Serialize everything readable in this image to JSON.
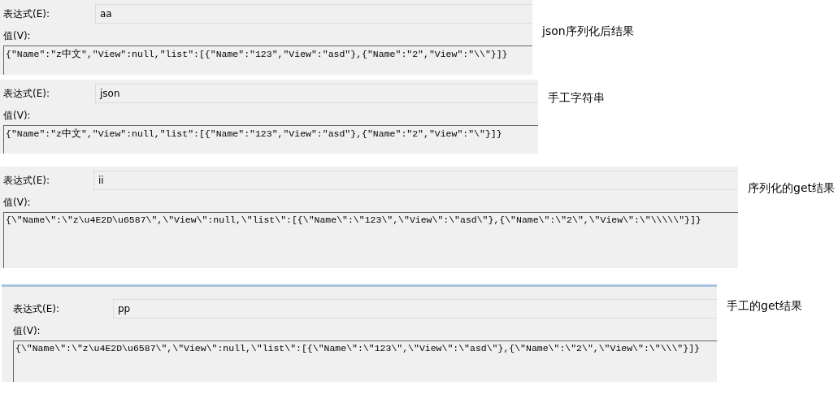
{
  "panels": [
    {
      "expression_label": "表达式(E):",
      "expression": "aa",
      "value_label": "值(V):",
      "value": "{\"Name\":\"z中文\",\"View\":null,\"list\":[{\"Name\":\"123\",\"View\":\"asd\"},{\"Name\":\"2\",\"View\":\"\\\\\"}]}",
      "caption": "json序列化后结果"
    },
    {
      "expression_label": "表达式(E):",
      "expression": "json",
      "value_label": "值(V):",
      "value": "{\"Name\":\"z中文\",\"View\":null,\"list\":[{\"Name\":\"123\",\"View\":\"asd\"},{\"Name\":\"2\",\"View\":\"\\\"}]}",
      "caption": "手工字符串"
    },
    {
      "expression_label": "表达式(E):",
      "expression": "ii",
      "value_label": "值(V):",
      "value": "{\\\"Name\\\":\\\"z\\u4E2D\\u6587\\\",\\\"View\\\":null,\\\"list\\\":[{\\\"Name\\\":\\\"123\\\",\\\"View\\\":\\\"asd\\\"},{\\\"Name\\\":\\\"2\\\",\\\"View\\\":\\\"\\\\\\\\\\\"}]}",
      "caption": "序列化的get结果"
    },
    {
      "expression_label": "表达式(E):",
      "expression": "pp",
      "value_label": "值(V):",
      "value": "{\\\"Name\\\":\\\"z\\u4E2D\\u6587\\\",\\\"View\\\":null,\\\"list\\\":[{\\\"Name\\\":\\\"123\\\",\\\"View\\\":\\\"asd\\\"},{\\\"Name\\\":\\\"2\\\",\\\"View\\\":\\\"\\\\\\\"}]}",
      "caption": "手工的get结果"
    }
  ]
}
